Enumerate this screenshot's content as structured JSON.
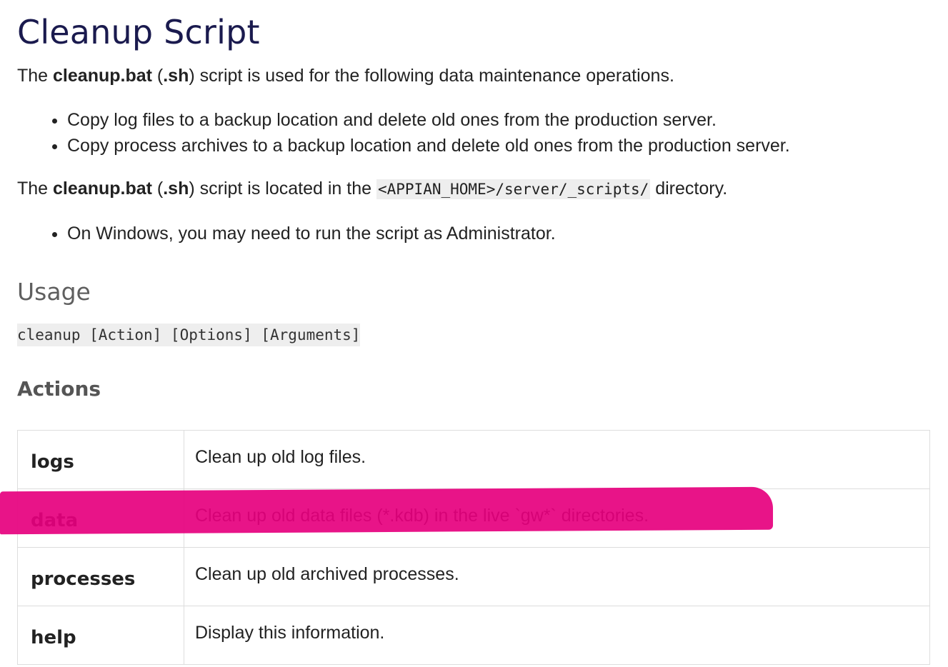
{
  "title": "Cleanup Script",
  "intro": {
    "prefix": "The ",
    "script_name": "cleanup.bat",
    "open_paren": " (",
    "script_ext": ".sh",
    "suffix": ") script is used for the following data maintenance operations."
  },
  "operations": [
    "Copy log files to a backup location and delete old ones from the production server.",
    "Copy process archives to a backup location and delete old ones from the production server."
  ],
  "location": {
    "prefix": "The ",
    "script_name": "cleanup.bat",
    "open_paren": " (",
    "script_ext": ".sh",
    "middle": ") script is located in the ",
    "path": "<APPIAN_HOME>/server/_scripts/",
    "suffix": " directory."
  },
  "notes": [
    "On Windows, you may need to run the script as Administrator."
  ],
  "usage": {
    "heading": "Usage",
    "command": "cleanup [Action] [Options] [Arguments]"
  },
  "actions": {
    "heading": "Actions",
    "rows": [
      {
        "name": "logs",
        "description": "Clean up old log files."
      },
      {
        "name": "data",
        "description": "Clean up old data files (*.kdb) in the live `gw*` directories."
      },
      {
        "name": "processes",
        "description": "Clean up old archived processes."
      },
      {
        "name": "help",
        "description": "Display this information."
      }
    ]
  },
  "colors": {
    "title": "#1a1a4e",
    "highlight": "#e6007e",
    "code_background": "#eeeeee"
  }
}
